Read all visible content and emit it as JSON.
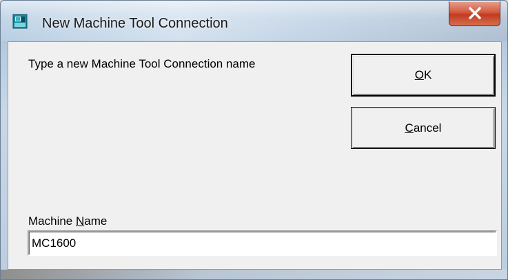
{
  "window": {
    "title": "New Machine Tool Connection",
    "icon": "machine-tool-app-icon",
    "close_icon": "close-icon"
  },
  "dialog": {
    "prompt": "Type a new Machine Tool Connection name",
    "ok_button": {
      "mnemonic": "O",
      "rest": "K"
    },
    "cancel_button": {
      "mnemonic": "C",
      "rest": "ancel"
    },
    "machine_name_label": {
      "before": "Machine ",
      "mnemonic": "N",
      "after": "ame"
    },
    "machine_name_value": "MC1600"
  },
  "colors": {
    "close_button": "#c23a1f",
    "dialog_face": "#f0f0f0"
  }
}
